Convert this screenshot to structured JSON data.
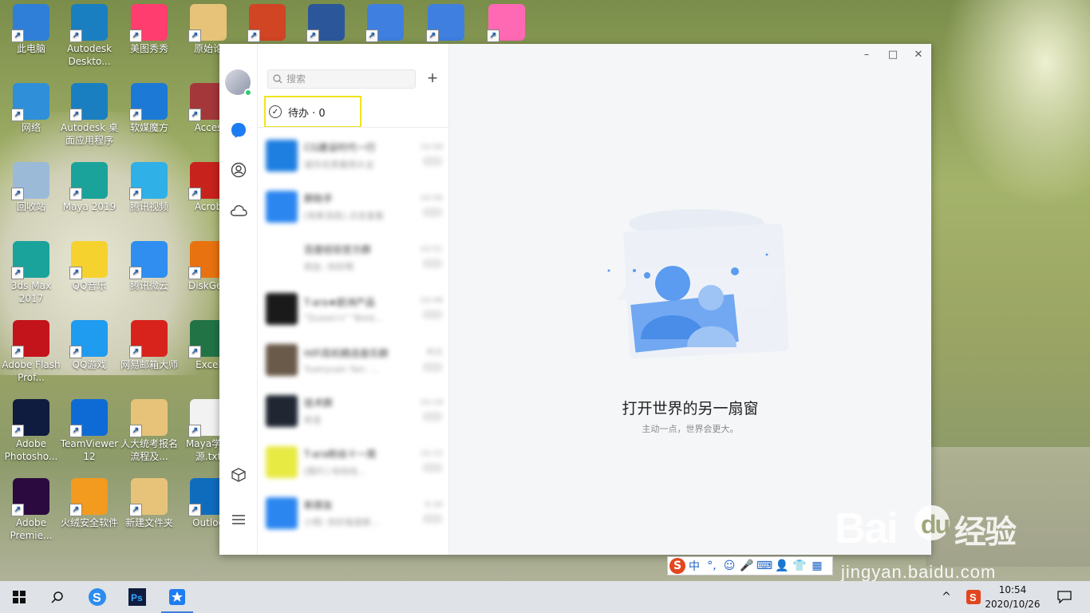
{
  "desktop": {
    "icons": [
      {
        "label": "此电脑",
        "color": "#2f7fd8"
      },
      {
        "label": "Autodesk Deskto...",
        "color": "#1a7fc1"
      },
      {
        "label": "美图秀秀",
        "color": "#ff3d6e"
      },
      {
        "label": "原始论",
        "color": "#e7c37a"
      },
      {
        "label": "",
        "color": "#d14424"
      },
      {
        "label": "",
        "color": "#2b579a"
      },
      {
        "label": "",
        "color": "#3f7fe0"
      },
      {
        "label": "",
        "color": "#3f7fe0"
      },
      {
        "label": "",
        "color": "#ff69b4"
      },
      {
        "label": "网络",
        "color": "#2f8fd8"
      },
      {
        "label": "Autodesk 桌面应用程序",
        "color": "#1a7fc1"
      },
      {
        "label": "软媒魔方",
        "color": "#1c7ad6"
      },
      {
        "label": "Acces",
        "color": "#a4373a"
      },
      {
        "label": "回收站",
        "color": "#9bbad8"
      },
      {
        "label": "Maya 2019",
        "color": "#1aa39b"
      },
      {
        "label": "腾讯视频",
        "color": "#2fb0e6"
      },
      {
        "label": "Acrob",
        "color": "#c8221d"
      },
      {
        "label": "3ds Max 2017",
        "color": "#1aa39b"
      },
      {
        "label": "QQ音乐",
        "color": "#f6d22f"
      },
      {
        "label": "腾讯微云",
        "color": "#2f8ef0"
      },
      {
        "label": "DiskGen",
        "color": "#e8720f"
      },
      {
        "label": "Adobe Flash Prof...",
        "color": "#c4141b"
      },
      {
        "label": "QQ游戏",
        "color": "#1f9bf0"
      },
      {
        "label": "网易邮箱大师",
        "color": "#d8231c"
      },
      {
        "label": "Excel",
        "color": "#217346"
      },
      {
        "label": "Adobe Photosho...",
        "color": "#0f1c3f"
      },
      {
        "label": "TeamViewer 12",
        "color": "#0e6bd6"
      },
      {
        "label": "人大统考报名流程及...",
        "color": "#e7c37a"
      },
      {
        "label": "Maya学习源.txt",
        "color": "#f2f2f2"
      },
      {
        "label": "Adobe Premie...",
        "color": "#2a0a3f"
      },
      {
        "label": "火绒安全软件",
        "color": "#f29b1f"
      },
      {
        "label": "新建文件夹",
        "color": "#e7c37a"
      },
      {
        "label": "Outloo",
        "color": "#0f6cbd"
      }
    ]
  },
  "qq": {
    "search": {
      "placeholder": "搜索"
    },
    "add_label": "+",
    "todo": {
      "label": "待办 · 0"
    },
    "chats": [
      {
        "name": "CG建设时代一行",
        "preview": "城市优秀案例大全",
        "time": "10:58",
        "color": "#1f7fe0"
      },
      {
        "name": "群助手",
        "preview": "[有新消息] 点击查看",
        "time": "10:56",
        "color": "#2b86f0"
      },
      {
        "name": "百度经验官方群",
        "preview": "网友: 你好啊",
        "time": "10:51",
        "color": "#ffffff"
      },
      {
        "name": "T-ara★欧洲产品",
        "preview": "\"Queen's\" \"Bold...",
        "time": "10:48",
        "color": "#1a1a1a"
      },
      {
        "name": "HiFi耳机精选音乐群",
        "preview": "Yuanyuan Yan: ...",
        "time": "昨天",
        "color": "#6a5a4a"
      },
      {
        "name": "技术群",
        "preview": "转发",
        "time": "10:18",
        "color": "#202632"
      },
      {
        "name": "T-ara粉丝十一周",
        "preview": "[图片] 咕咕咕...",
        "time": "10:15",
        "color": "#e8ea44"
      },
      {
        "name": "新朋友",
        "preview": "小明: 你好我是新...",
        "time": "9:30",
        "color": "#2b86f0"
      }
    ],
    "window_controls": {
      "minimize": "–",
      "maximize": "□",
      "close": "✕"
    },
    "empty_state": {
      "title": "打开世界的另一扇窗",
      "subtitle": "主动一点，世界会更大。"
    }
  },
  "ime": {
    "logo": "S",
    "mode": "中",
    "punct": "°,",
    "emoji": "☺",
    "mic": "🎤",
    "keyboard": "⌨",
    "user": "👤",
    "skin": "👕",
    "grid": "▦"
  },
  "watermark": {
    "logo": "Bai du 经验",
    "url": "jingyan.baidu.com"
  },
  "taskbar": {
    "time": "10:54",
    "date": "2020/10/26",
    "tray_arrow": "^",
    "notification": "🗨"
  }
}
